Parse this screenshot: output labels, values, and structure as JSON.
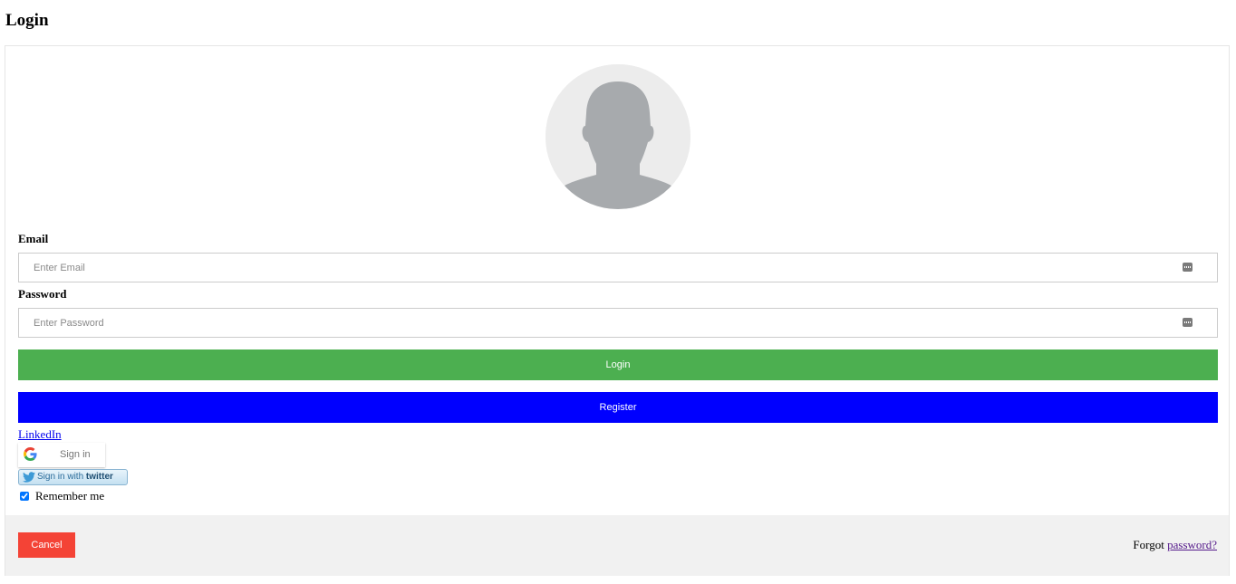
{
  "page": {
    "title": "Login"
  },
  "avatar": {
    "icon": "user-avatar-icon"
  },
  "email": {
    "label": "Email",
    "placeholder": "Enter Email",
    "value": ""
  },
  "password": {
    "label": "Password",
    "placeholder": "Enter Password",
    "value": ""
  },
  "buttons": {
    "login": "Login",
    "register": "Register",
    "cancel": "Cancel"
  },
  "social": {
    "linkedin": "LinkedIn",
    "google": "Sign in",
    "twitter_prefix": "Sign in with",
    "twitter_brand": "twitter"
  },
  "remember": {
    "label": "Remember me",
    "checked": true
  },
  "forgot": {
    "text": "Forgot",
    "link": "password?"
  },
  "colors": {
    "login_button": "#4caf50",
    "register_button": "#0000ff",
    "cancel_button": "#f44336",
    "footer_background": "#f1f1f1"
  }
}
